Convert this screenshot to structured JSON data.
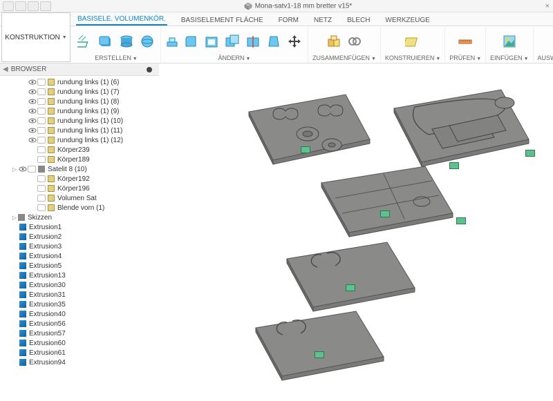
{
  "titlebar": {
    "title": "Mona-satv1-18 mm bretter v15*",
    "close": "×"
  },
  "tabs": [
    {
      "label": "BASISELE. VOLUMENKÖR.",
      "active": true
    },
    {
      "label": "BASISELEMENT FLÄCHE"
    },
    {
      "label": "FORM"
    },
    {
      "label": "NETZ"
    },
    {
      "label": "BLECH"
    },
    {
      "label": "WERKZEUGE"
    }
  ],
  "ribbon": {
    "konstruktion": "KONSTRUKTION",
    "groups": {
      "erstellen": "ERSTELLEN",
      "aendern": "ÄNDERN",
      "zusammenfuegen": "ZUSAMMENFÜGEN",
      "konstruieren": "KONSTRUIEREN",
      "pruefen": "PRÜFEN",
      "einfuegen": "EINFÜGEN",
      "auswaehlen": "AUSWÄHLEN"
    }
  },
  "browser": {
    "title": "BROWSER",
    "tree": [
      {
        "indent": 40,
        "eye": true,
        "sel": true,
        "icon": "body",
        "label": "rundung links (1) (6)"
      },
      {
        "indent": 40,
        "eye": true,
        "sel": true,
        "icon": "body",
        "label": "rundung links (1) (7)"
      },
      {
        "indent": 40,
        "eye": true,
        "sel": true,
        "icon": "body",
        "label": "rundung links (1) (8)"
      },
      {
        "indent": 40,
        "eye": true,
        "sel": true,
        "icon": "body",
        "label": "rundung links (1) (9)"
      },
      {
        "indent": 40,
        "eye": true,
        "sel": true,
        "icon": "body",
        "label": "rundung links (1) (10)"
      },
      {
        "indent": 40,
        "eye": true,
        "sel": true,
        "icon": "body",
        "label": "rundung links (1) (11)"
      },
      {
        "indent": 40,
        "eye": true,
        "sel": true,
        "icon": "body",
        "label": "rundung links (1) (12)"
      },
      {
        "indent": 40,
        "eye": false,
        "sel": true,
        "icon": "body",
        "label": "Körper239"
      },
      {
        "indent": 40,
        "eye": false,
        "sel": true,
        "icon": "body",
        "label": "Körper189"
      },
      {
        "indent": 16,
        "twisty": "▷",
        "eye": true,
        "sel": true,
        "icon": "folder",
        "label": "Satelit 8 (10)"
      },
      {
        "indent": 40,
        "eye": false,
        "sel": true,
        "icon": "body",
        "label": "Körper192"
      },
      {
        "indent": 40,
        "eye": false,
        "sel": true,
        "icon": "body",
        "label": "Körper196"
      },
      {
        "indent": 40,
        "eye": false,
        "sel": true,
        "icon": "body",
        "label": "Volumen Sat"
      },
      {
        "indent": 40,
        "eye": false,
        "sel": true,
        "icon": "body",
        "label": "Blende vorn (1)"
      },
      {
        "indent": 16,
        "twisty": "▷",
        "icon": "folder",
        "label": "Skizzen"
      },
      {
        "indent": 28,
        "icon": "sketch",
        "label": "Extrusion1"
      },
      {
        "indent": 28,
        "icon": "sketch",
        "label": "Extrusion2"
      },
      {
        "indent": 28,
        "icon": "sketch",
        "label": "Extrusion3"
      },
      {
        "indent": 28,
        "icon": "sketch",
        "label": "Extrusion4"
      },
      {
        "indent": 28,
        "icon": "sketch",
        "label": "Extrusion5"
      },
      {
        "indent": 28,
        "icon": "sketch",
        "label": "Extrusion13"
      },
      {
        "indent": 28,
        "icon": "sketch",
        "label": "Extrusion30"
      },
      {
        "indent": 28,
        "icon": "sketch",
        "label": "Extrusion31"
      },
      {
        "indent": 28,
        "icon": "sketch",
        "label": "Extrusion35"
      },
      {
        "indent": 28,
        "icon": "sketch",
        "label": "Extrusion40"
      },
      {
        "indent": 28,
        "icon": "sketch",
        "label": "Extrusion56"
      },
      {
        "indent": 28,
        "icon": "sketch",
        "label": "Extrusion57"
      },
      {
        "indent": 28,
        "icon": "sketch",
        "label": "Extrusion60"
      },
      {
        "indent": 28,
        "icon": "sketch",
        "label": "Extrusion61"
      },
      {
        "indent": 28,
        "icon": "sketch",
        "label": "Extrusion94"
      }
    ]
  },
  "colors": {
    "plate_fill": "#8a8a88",
    "plate_edge": "#555"
  }
}
